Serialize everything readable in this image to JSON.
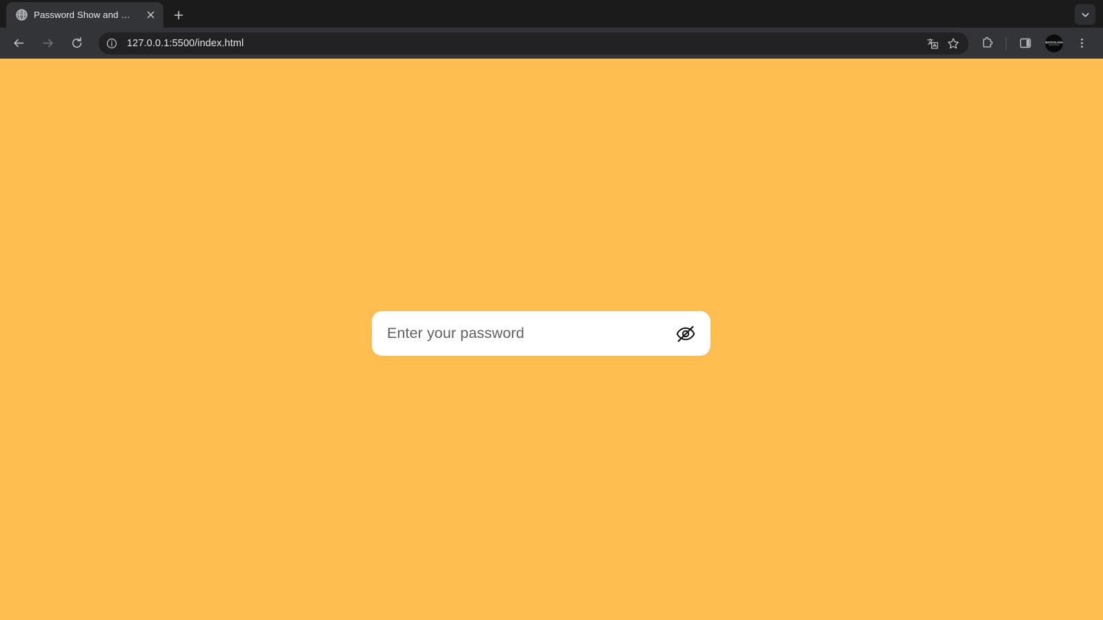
{
  "browser": {
    "tab_strip": {
      "tabs": [
        {
          "title": "Password Show and Hide",
          "favicon": "globe-icon",
          "close_label": "×",
          "active": true
        }
      ],
      "new_tab_label": "+",
      "tab_list_icon": "chevron-down-icon"
    },
    "toolbar": {
      "back_icon": "back-arrow-icon",
      "forward_icon": "forward-arrow-icon",
      "reload_icon": "reload-icon",
      "site_info_icon": "info-circle-icon",
      "url": "127.0.0.1:5500/index.html",
      "translate_icon": "translate-icon",
      "bookmark_icon": "star-icon",
      "extensions_icon": "puzzle-piece-icon",
      "side_panel_icon": "side-panel-icon",
      "menu_icon": "three-dot-menu-icon",
      "avatar": {
        "name": "profile-avatar",
        "line1": "BACKSLASH",
        "line2": "DEVELOPER"
      }
    }
  },
  "page": {
    "background_color": "#ffbe4f",
    "password_field": {
      "placeholder": "Enter your password",
      "value": "",
      "type": "password",
      "toggle_icon": "eye-slash-icon",
      "toggle_state": "hidden",
      "card_color": "#ffffff"
    }
  }
}
